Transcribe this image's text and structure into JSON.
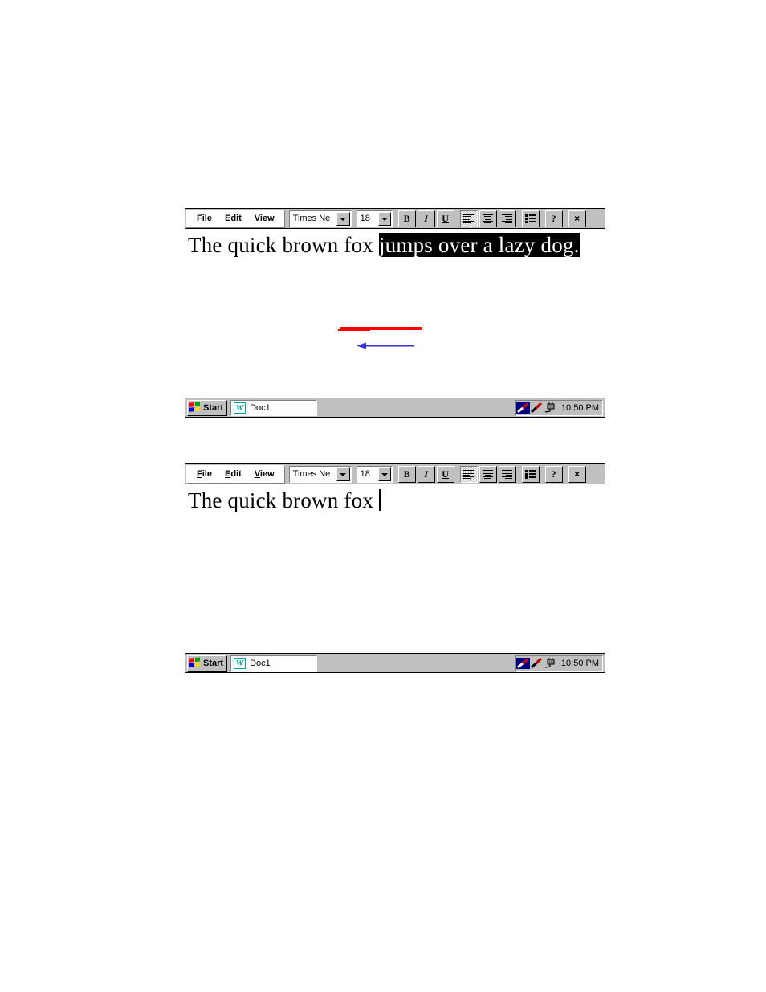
{
  "windows": [
    {
      "id": "top",
      "toolbar": {
        "menus": [
          {
            "name": "file",
            "accel": "F",
            "rest": "ile"
          },
          {
            "name": "edit",
            "accel": "E",
            "rest": "dit"
          },
          {
            "name": "view",
            "accel": "V",
            "rest": "iew"
          }
        ],
        "font_name": "Times Ne",
        "font_size": "18",
        "buttons": [
          {
            "name": "bold-button",
            "label": "B"
          },
          {
            "name": "italic-button",
            "label": "I"
          },
          {
            "name": "underline-button",
            "label": "U"
          },
          {
            "name": "align-left-button",
            "label": "",
            "pressed": true
          },
          {
            "name": "align-center-button",
            "label": ""
          },
          {
            "name": "align-right-button",
            "label": ""
          },
          {
            "name": "bullet-list-button",
            "label": ""
          },
          {
            "name": "help-button",
            "label": "?"
          },
          {
            "name": "close-button",
            "label": "×"
          }
        ]
      },
      "document": {
        "plain_text": "The quick brown fox ",
        "selected_text": "jumps over a lazy dog.",
        "has_caret": false
      },
      "annotations": {
        "red_stroke_color": "#ff0000",
        "blue_arrow_color": "#3333cc",
        "blue_arrow_direction": "left"
      },
      "statusbar": {
        "start_label": "Start",
        "task_label": "Doc1",
        "task_icon": "word-document-icon",
        "clock": "10:50 PM"
      }
    },
    {
      "id": "bottom",
      "toolbar": {
        "menus": [
          {
            "name": "file",
            "accel": "F",
            "rest": "ile"
          },
          {
            "name": "edit",
            "accel": "E",
            "rest": "dit"
          },
          {
            "name": "view",
            "accel": "V",
            "rest": "iew"
          }
        ],
        "font_name": "Times Ne",
        "font_size": "18",
        "buttons": [
          {
            "name": "bold-button",
            "label": "B"
          },
          {
            "name": "italic-button",
            "label": "I"
          },
          {
            "name": "underline-button",
            "label": "U"
          },
          {
            "name": "align-left-button",
            "label": "",
            "pressed": true
          },
          {
            "name": "align-center-button",
            "label": ""
          },
          {
            "name": "align-right-button",
            "label": ""
          },
          {
            "name": "bullet-list-button",
            "label": ""
          },
          {
            "name": "help-button",
            "label": "?"
          },
          {
            "name": "close-button",
            "label": "×"
          }
        ]
      },
      "document": {
        "plain_text": "The quick brown fox ",
        "selected_text": "",
        "has_caret": true
      },
      "annotations": null,
      "statusbar": {
        "start_label": "Start",
        "task_label": "Doc1",
        "task_icon": "word-document-icon",
        "clock": "10:50 PM"
      }
    }
  ],
  "colors": {
    "chrome": "#c0c0c0",
    "selection": "#000000",
    "annotation_red": "#ff0000",
    "annotation_blue": "#3333cc",
    "word_icon_teal": "#00a0a0"
  }
}
